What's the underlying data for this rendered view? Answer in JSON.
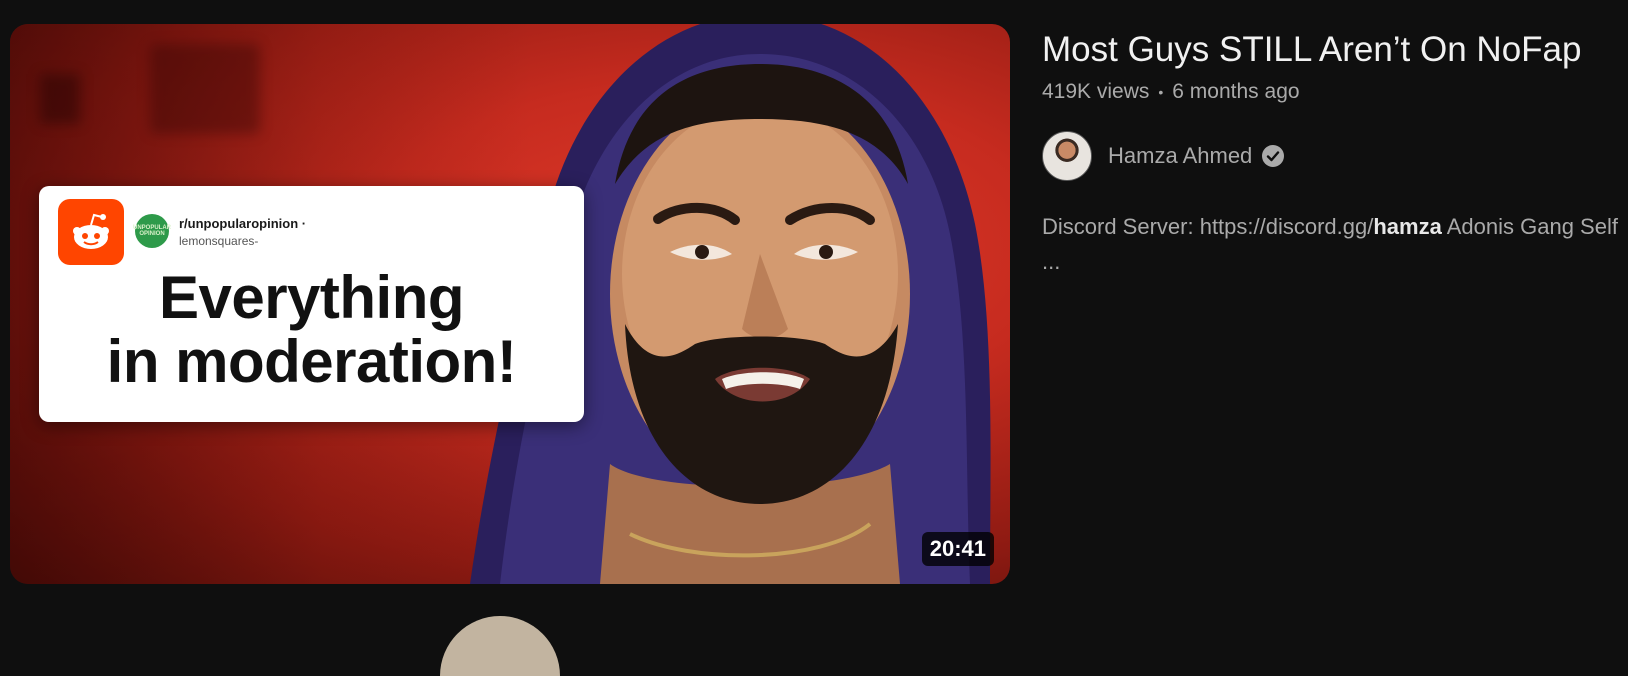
{
  "video": {
    "duration": "20:41",
    "title": "Most Guys STILL Aren’t On NoFap",
    "views": "419K views",
    "separator": "•",
    "age": "6 months ago",
    "channel_name": "Hamza Ahmed",
    "description_prefix": "Discord Server: https://discord.gg/",
    "description_bold": "hamza",
    "description_suffix": " Adonis Gang Self ..."
  },
  "thumbnail": {
    "subreddit": "r/unpopularopinion ·",
    "username": "lemonsquares-",
    "sub_badge": "UNPOPULAR OPINION",
    "headline_line1": "Everything",
    "headline_line2": "in moderation!"
  },
  "icons": {
    "verified": "verified-check-icon",
    "reddit": "reddit-logo-icon"
  },
  "colors": {
    "background": "#0f0f0f",
    "title": "#f1f1f1",
    "meta": "#aaaaaa",
    "thumbnail_red": "#c62b1f",
    "reddit_orange": "#ff4500"
  }
}
